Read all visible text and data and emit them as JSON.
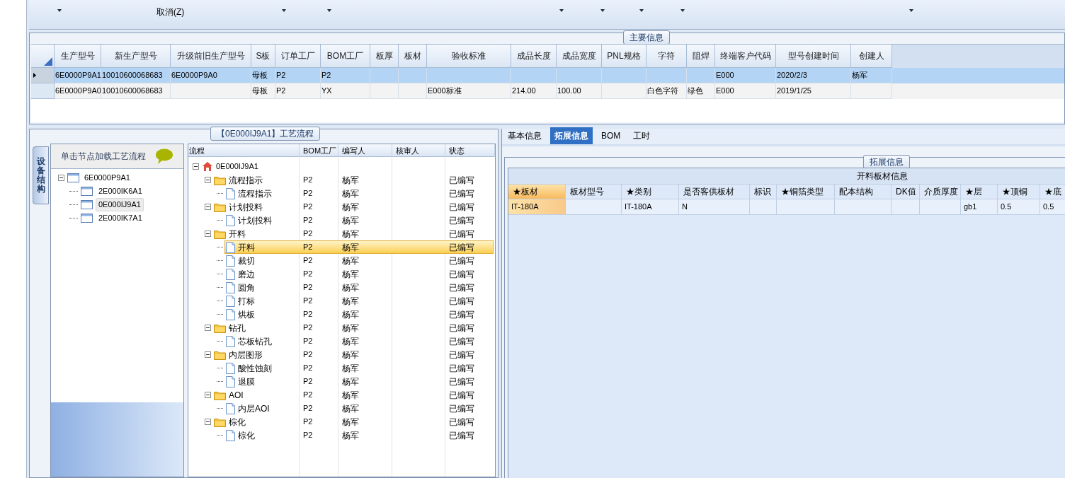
{
  "toolbar": {
    "cancel_label": "取消(Z)"
  },
  "main_info": {
    "title": "主要信息",
    "columns": [
      "生产型号",
      "新生产型号",
      "升级前旧生产型号",
      "S板",
      "订单工厂",
      "BOM工厂",
      "板厚",
      "板材",
      "验收标准",
      "成品长度",
      "成品宽度",
      "PNL规格",
      "字符",
      "阻焊",
      "终端客户代码",
      "型号创建时间",
      "创建人"
    ],
    "rows": [
      {
        "selected": true,
        "cells": [
          "6E0000P9A1",
          "10010600068683",
          "6E0000P9A0",
          "母板",
          "P2",
          "P2",
          "",
          "",
          "",
          "",
          "",
          "",
          "",
          "",
          "E000",
          "2020/2/3",
          "杨军"
        ]
      },
      {
        "selected": false,
        "cells": [
          "6E0000P9A0",
          "10010600068683",
          "",
          "母板",
          "P2",
          "YX",
          "",
          "",
          "E000标准",
          "214.00",
          "100.00",
          "",
          "白色字符",
          "绿色",
          "E000",
          "2019/1/25",
          ""
        ]
      }
    ]
  },
  "process_panel": {
    "title": "【0E000IJ9A1】工艺流程",
    "side_tab": "设备结构",
    "tree": {
      "header": "单击节点加载工艺流程",
      "nodes": [
        {
          "label": "6E0000P9A1",
          "expanded": true,
          "selected": false,
          "children": [
            {
              "label": "2E000IK6A1",
              "selected": false
            },
            {
              "label": "0E000IJ9A1",
              "selected": true
            },
            {
              "label": "2E000IK7A1",
              "selected": false
            }
          ]
        }
      ]
    },
    "grid": {
      "columns": [
        "流程",
        "BOM工厂",
        "编写人",
        "核审人",
        "状态"
      ],
      "rows": [
        {
          "kind": "root",
          "label": "0E000IJ9A1",
          "expanded": true,
          "selected": false,
          "children": [
            {
              "kind": "folder",
              "label": "流程指示",
              "bom": "P2",
              "writer": "杨军",
              "status": "已编写",
              "expanded": true,
              "selected": false,
              "children": [
                {
                  "kind": "file",
                  "label": "流程指示",
                  "bom": "P2",
                  "writer": "杨军",
                  "status": "已编写",
                  "selected": false
                }
              ]
            },
            {
              "kind": "folder",
              "label": "计划投料",
              "bom": "P2",
              "writer": "杨军",
              "status": "已编写",
              "expanded": true,
              "selected": false,
              "children": [
                {
                  "kind": "file",
                  "label": "计划投料",
                  "bom": "P2",
                  "writer": "杨军",
                  "status": "已编写",
                  "selected": false
                }
              ]
            },
            {
              "kind": "folder",
              "label": "开料",
              "bom": "P2",
              "writer": "杨军",
              "status": "已编写",
              "expanded": true,
              "selected": false,
              "children": [
                {
                  "kind": "file",
                  "label": "开料",
                  "bom": "P2",
                  "writer": "杨军",
                  "status": "已编写",
                  "selected": true
                },
                {
                  "kind": "file",
                  "label": "裁切",
                  "bom": "P2",
                  "writer": "杨军",
                  "status": "已编写",
                  "selected": false
                },
                {
                  "kind": "file",
                  "label": "磨边",
                  "bom": "P2",
                  "writer": "杨军",
                  "status": "已编写",
                  "selected": false
                },
                {
                  "kind": "file",
                  "label": "圆角",
                  "bom": "P2",
                  "writer": "杨军",
                  "status": "已编写",
                  "selected": false
                },
                {
                  "kind": "file",
                  "label": "打标",
                  "bom": "P2",
                  "writer": "杨军",
                  "status": "已编写",
                  "selected": false
                },
                {
                  "kind": "file",
                  "label": "烘板",
                  "bom": "P2",
                  "writer": "杨军",
                  "status": "已编写",
                  "selected": false
                }
              ]
            },
            {
              "kind": "folder",
              "label": "钻孔",
              "bom": "P2",
              "writer": "杨军",
              "status": "已编写",
              "expanded": true,
              "selected": false,
              "children": [
                {
                  "kind": "file",
                  "label": "芯板钻孔",
                  "bom": "P2",
                  "writer": "杨军",
                  "status": "已编写",
                  "selected": false
                }
              ]
            },
            {
              "kind": "folder",
              "label": "内层图形",
              "bom": "P2",
              "writer": "杨军",
              "status": "已编写",
              "expanded": true,
              "selected": false,
              "children": [
                {
                  "kind": "file",
                  "label": "酸性蚀刻",
                  "bom": "P2",
                  "writer": "杨军",
                  "status": "已编写",
                  "selected": false
                },
                {
                  "kind": "file",
                  "label": "退膜",
                  "bom": "P2",
                  "writer": "杨军",
                  "status": "已编写",
                  "selected": false
                }
              ]
            },
            {
              "kind": "folder",
              "label": "AOI",
              "bom": "P2",
              "writer": "杨军",
              "status": "已编写",
              "expanded": true,
              "selected": false,
              "children": [
                {
                  "kind": "file",
                  "label": "内层AOI",
                  "bom": "P2",
                  "writer": "杨军",
                  "status": "已编写",
                  "selected": false
                }
              ]
            },
            {
              "kind": "folder",
              "label": "棕化",
              "bom": "P2",
              "writer": "杨军",
              "status": "已编写",
              "expanded": true,
              "selected": false,
              "children": [
                {
                  "kind": "file",
                  "label": "棕化",
                  "bom": "P2",
                  "writer": "杨军",
                  "status": "已编写",
                  "selected": false
                }
              ]
            }
          ]
        }
      ]
    }
  },
  "detail_panel": {
    "tabs": [
      {
        "label": "基本信息",
        "selected": false
      },
      {
        "label": "拓展信息",
        "selected": true
      },
      {
        "label": "BOM",
        "selected": false
      },
      {
        "label": "工时",
        "selected": false
      }
    ],
    "group_title": "拓展信息",
    "table_title": "开料板材信息",
    "columns": [
      {
        "label": "★板材",
        "selected": true
      },
      {
        "label": "板材型号",
        "selected": false
      },
      {
        "label": "★类别",
        "selected": false
      },
      {
        "label": "是否客供板材",
        "selected": false
      },
      {
        "label": "标识",
        "selected": false
      },
      {
        "label": "★铜箔类型",
        "selected": false
      },
      {
        "label": "配本结构",
        "selected": false
      },
      {
        "label": "DK值",
        "selected": false
      },
      {
        "label": "介质厚度",
        "selected": false
      },
      {
        "label": "★层",
        "selected": false
      },
      {
        "label": "★顶铜",
        "selected": false
      },
      {
        "label": "★底",
        "selected": false
      }
    ],
    "rows": [
      {
        "cells": [
          "IT-180A",
          "",
          "IT-180A",
          "N",
          "",
          "",
          "",
          "",
          "",
          "gb1",
          "0.5",
          "0.5"
        ]
      }
    ]
  }
}
